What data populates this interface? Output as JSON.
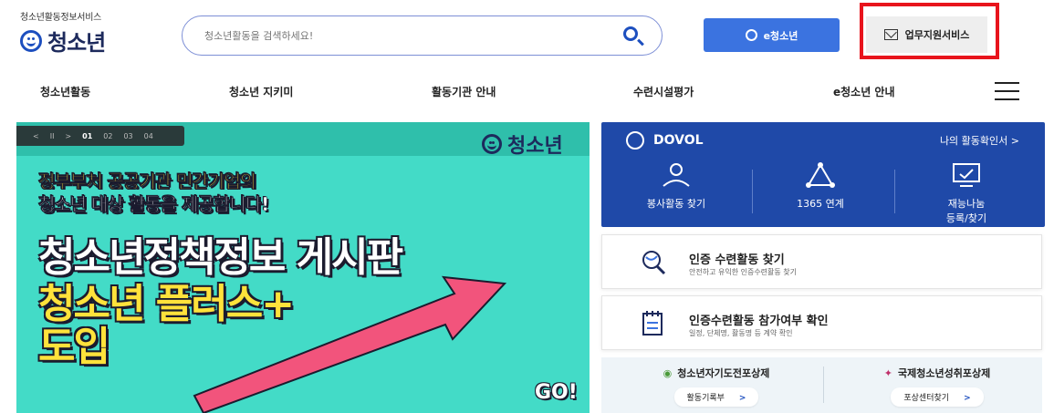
{
  "logo": {
    "subtitle": "청소년활동정보서비스",
    "title": "청소년"
  },
  "search": {
    "placeholder": "청소년활동을 검색하세요!"
  },
  "header_buttons": {
    "e_youth": "e청소년",
    "work_support": "업무지원서비스"
  },
  "nav": {
    "items": [
      "청소년활동",
      "청소년 지키미",
      "활동기관 안내",
      "수련시설평가",
      "e청소년 안내"
    ]
  },
  "banner": {
    "controls": {
      "prev": "<",
      "pause": "II",
      "next": ">",
      "slides": [
        "01",
        "02",
        "03",
        "04"
      ],
      "active_slide": "01"
    },
    "logo": "청소년",
    "line1": "정부부처 공공기관 민간기업의",
    "line2": "청소년 대상 활동을 제공합니다!",
    "line3": "청소년정책정보 게시판",
    "line4": "청소년 플러스+",
    "line5": "도입",
    "go": "GO!"
  },
  "dovol": {
    "title": "DOVOL",
    "link": "나의 활동확인서 >",
    "items": [
      {
        "label": "봉사활동 찾기",
        "icon": "volunteer-icon"
      },
      {
        "label": "1365 연계",
        "icon": "network-icon"
      },
      {
        "label_line1": "재능나눔",
        "label_line2": "등록/찾기",
        "icon": "monitor-icon"
      }
    ]
  },
  "cards": [
    {
      "title": "인증 수련활동 찾기",
      "subtitle": "안전하고 유익한 인증수련활동 찾기",
      "icon": "search-globe-icon"
    },
    {
      "title": "인증수련활동 참가여부 확인",
      "subtitle": "일정, 단체명, 활동명 등 계약 확인",
      "icon": "notepad-icon"
    }
  ],
  "awards": [
    {
      "title": "청소년자기도전포상제",
      "button": "활동기록부",
      "icon": "medal-icon"
    },
    {
      "title": "국제청소년성취포상제",
      "button": "포상센터찾기",
      "icon": "ribbon-icon"
    }
  ],
  "colors": {
    "brand_blue": "#1d4fbf",
    "button_blue": "#3b73e0",
    "banner_teal": "#43dbc7",
    "dovol_blue": "#1f49a8",
    "highlight_red": "#e8141c"
  }
}
